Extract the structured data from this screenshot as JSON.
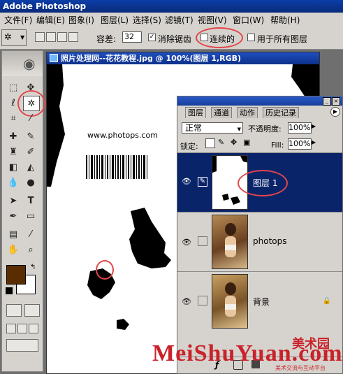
{
  "app": {
    "title": "Adobe Photoshop"
  },
  "menu": [
    "文件(F)",
    "编辑(E)",
    "图象(I)",
    "图层(L)",
    "选择(S)",
    "滤镜(T)",
    "视图(V)",
    "窗口(W)",
    "帮助(H)"
  ],
  "options": {
    "tolerance_label": "容差:",
    "tolerance_value": "32",
    "antialias_label": "消除锯齿",
    "antialias_checked": true,
    "contiguous_label": "连续的",
    "contiguous_checked": false,
    "all_layers_label": "用于所有图层",
    "all_layers_checked": false
  },
  "document": {
    "title": "照片处理网--花花教程.jpg @ 100%(图层 1,RGB)",
    "site_text": "www.photops.com"
  },
  "layers_panel": {
    "tabs": [
      "图层",
      "通道",
      "动作",
      "历史记录"
    ],
    "active_tab": "图层",
    "blend_mode": "正常",
    "opacity_label": "不透明度:",
    "opacity_value": "100%",
    "lock_label": "锁定:",
    "fill_label": "Fill:",
    "fill_value": "100%",
    "layers": [
      {
        "name": "图层 1",
        "selected": true
      },
      {
        "name": "photops",
        "selected": false
      },
      {
        "name": "背景",
        "selected": false
      }
    ]
  },
  "watermark": {
    "text": "MeiShuYuan.com",
    "brand": "美术园",
    "sub": "美术交流与互动平台"
  },
  "colors": {
    "foreground": "#5a2d00",
    "background": "#ffffff",
    "selection": "#0a246a",
    "annotation": "#e2464a",
    "watermark": "#c9222a"
  }
}
